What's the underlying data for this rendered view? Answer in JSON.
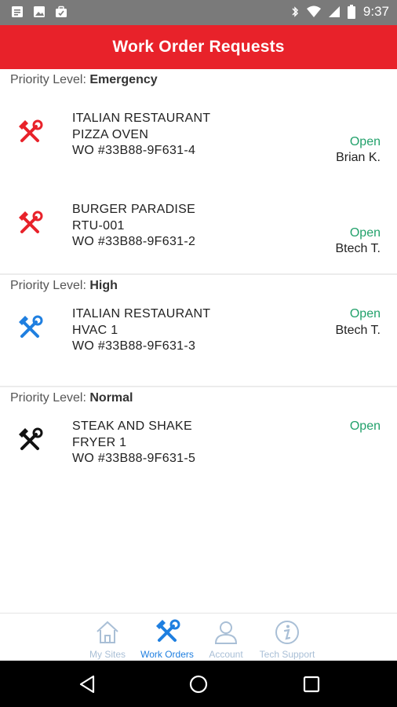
{
  "status_bar": {
    "time": "9:37"
  },
  "header": {
    "title": "Work Order Requests"
  },
  "groups": [
    {
      "prefix": "Priority Level: ",
      "level": "Emergency",
      "icon_color": "#e8222a",
      "items": [
        {
          "site": "ITALIAN RESTAURANT",
          "equipment": "PIZZA OVEN",
          "wo": "WO #33B88-9F631-4",
          "status": "Open",
          "tech": "Brian K."
        },
        {
          "site": "BURGER PARADISE",
          "equipment": "RTU-001",
          "wo": "WO #33B88-9F631-2",
          "status": "Open",
          "tech": "Btech T."
        }
      ]
    },
    {
      "prefix": "Priority Level: ",
      "level": "High",
      "icon_color": "#1f7fe0",
      "items": [
        {
          "site": "ITALIAN RESTAURANT",
          "equipment": "HVAC 1",
          "wo": "WO #33B88-9F631-3",
          "status": "Open",
          "tech": "Btech T."
        }
      ]
    },
    {
      "prefix": "Priority Level: ",
      "level": "Normal",
      "icon_color": "#111111",
      "items": [
        {
          "site": "STEAK AND SHAKE",
          "equipment": "FRYER 1",
          "wo": "WO #33B88-9F631-5",
          "status": "Open"
        }
      ]
    }
  ],
  "bottom_nav": {
    "tabs": [
      {
        "label": "My Sites",
        "icon": "home-icon"
      },
      {
        "label": "Work Orders",
        "icon": "tools-icon"
      },
      {
        "label": "Account",
        "icon": "person-icon"
      },
      {
        "label": "Tech Support",
        "icon": "info-icon"
      }
    ],
    "active_tab": "Work Orders"
  },
  "colors": {
    "header_bg": "#e8222a",
    "status_open": "#22a16b",
    "nav_active": "#1f7fe0",
    "nav_inactive": "#a9bfd6"
  }
}
